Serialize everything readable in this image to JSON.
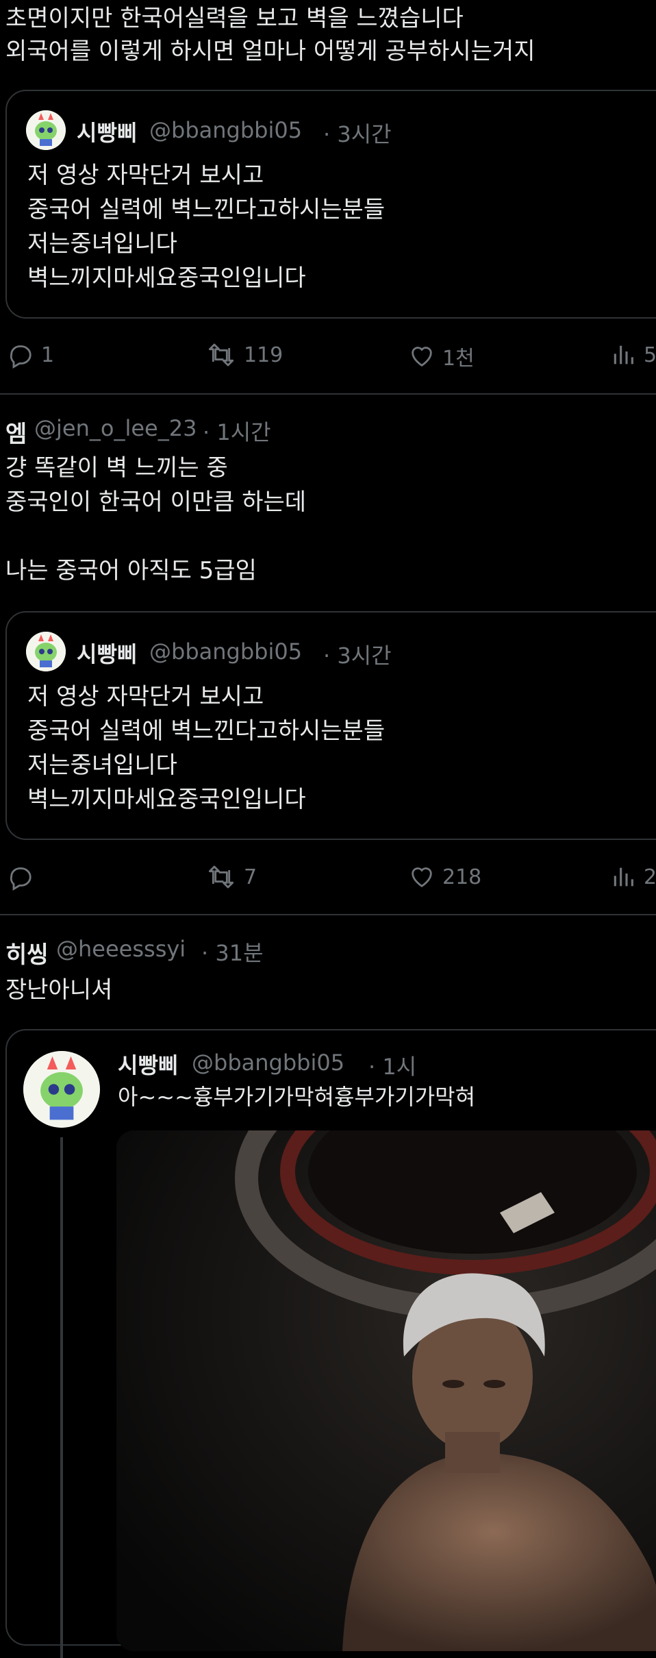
{
  "top_tweet": {
    "lines": [
      "초면이지만 한국어실력을 보고 벽을 느꼈습니다",
      "외국어를 이렇게 하시면 얼마나 어떻게 공부하시는거지"
    ],
    "quote": {
      "name": "시빵삐",
      "handle": "@bbangbbi05",
      "time": "· 3시간",
      "lines": [
        "저 영상 자막단거 보시고",
        "중국어 실력에 벽느낀다고하시는분들",
        "저는중녀입니다",
        "벽느끼지마세요중국인입니다"
      ]
    },
    "actions": {
      "reply": "1",
      "retweet": "119",
      "like": "1천",
      "views": "5"
    }
  },
  "second_tweet": {
    "name": "엠",
    "handle": "@jen_o_lee_23",
    "time": "· 1시간",
    "lines": [
      "걍 똑같이 벽 느끼는 중",
      "중국인이 한국어 이만큼 하는데",
      "",
      "나는 중국어 아직도 5급임"
    ],
    "quote": {
      "name": "시빵삐",
      "handle": "@bbangbbi05",
      "time": "· 3시간",
      "lines": [
        "저 영상 자막단거 보시고",
        "중국어 실력에 벽느낀다고하시는분들",
        "저는중녀입니다",
        "벽느끼지마세요중국인입니다"
      ]
    },
    "actions": {
      "reply": "",
      "retweet": "7",
      "like": "218",
      "views": "2"
    }
  },
  "third_tweet": {
    "name": "히씽",
    "handle": "@heeesssyi",
    "time": "· 31분",
    "lines": [
      "장난아니셔"
    ],
    "quote": {
      "name": "시빵삐",
      "handle": "@bbangbbi05",
      "time": "· 1시",
      "text": "아~~~흉부가기가막혀흉부가기가막혀"
    }
  },
  "icons": [
    "reply-icon",
    "retweet-icon",
    "like-icon",
    "views-icon"
  ]
}
